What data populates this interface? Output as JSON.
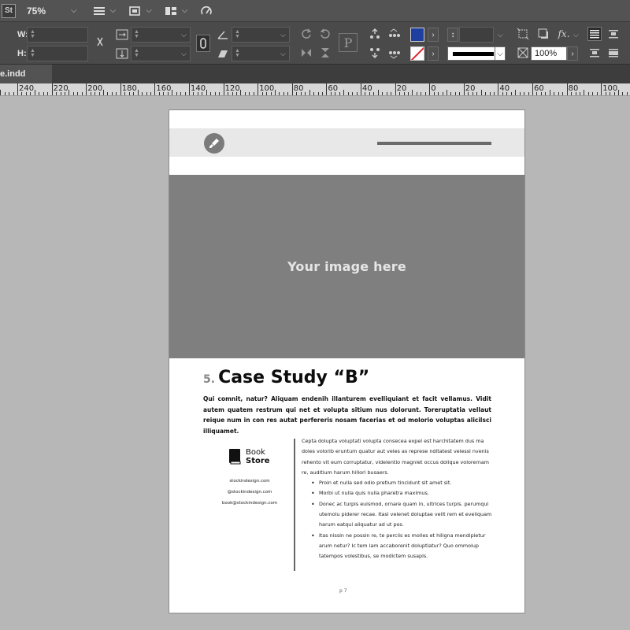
{
  "app": {
    "logo": "St",
    "zoom": "75%"
  },
  "control_panel": {
    "w_label": "W:",
    "h_label": "H:",
    "stroke_weight_percent": "100%",
    "fx_label": "fx.",
    "fill_color": "#1f3fa0"
  },
  "document": {
    "tab_label": "e.indd"
  },
  "ruler": {
    "labels": [
      "240",
      "220",
      "200",
      "180",
      "160",
      "140",
      "120",
      "100",
      "80",
      "60",
      "40",
      "20",
      "0",
      "20",
      "40",
      "60",
      "80",
      "100"
    ]
  },
  "page": {
    "image_placeholder": "Your image here",
    "section_number": "5.",
    "title": "Case Study “B”",
    "intro": "Qui comnit, natur? Aliquam endenih illanturem evelliquiant et facit vellamus. Vidit autem quatem restrum qui net et volupta sitium nus dolorunt. Toreruptatia vellaut reique num in con res autat perfereris nosam facerias et od molorio voluptas alicilsci illiquamet.",
    "brand": {
      "line1": "Book",
      "line2": "Store"
    },
    "contacts": [
      "stockindesign.com",
      "@stockindesign.com",
      "book@stockindesign.com"
    ],
    "body_paragraph": "Cepta dolupta voluptati volupta consecea expel est harchitatem dus ma doles volorib eruntum quatur aut veles as represe nditatest velessi nvenis rehento vit eum corruptatur, videlentio magniet occus dolique volorernam re, auditium harum hillori busaers.",
    "bullets": [
      "Proin et nulla sed odio pretium tincidunt sit amet sit.",
      "Morbi ut nulla quis nulla pharetra maximus.",
      "Donec ac turpis euismod, ornare quam in, ultrices turpis. perumqui utemolu piderer recae. Itasi velenet doluptae velit rem et eveliquam harum eatqui aliquatur ad ut pos.",
      "Itas nissin ne possin re, te perciis es molles et hiligna mendipietur arum netur? Ic tem lam accaborenit doluptiatur? Quo ommolup tatempos volestibus, se modictem susapis."
    ],
    "page_number": "p 7"
  }
}
